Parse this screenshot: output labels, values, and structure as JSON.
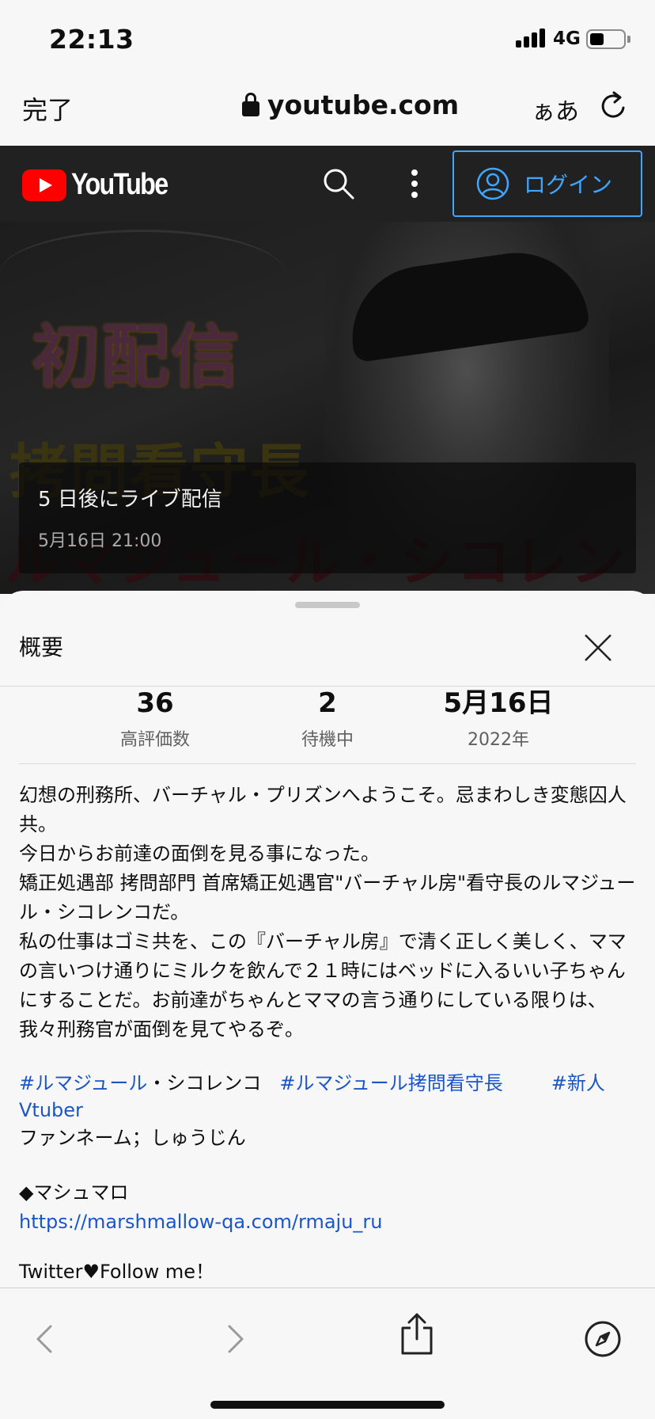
{
  "status_bar": {
    "time": "22:13",
    "network": "4G"
  },
  "safari": {
    "done_label": "完了",
    "address": "youtube.com",
    "text_size_label": "ぁあ"
  },
  "youtube": {
    "logo_text": "YouTube",
    "login_label": "ログイン"
  },
  "video": {
    "thumbnail_title": "初配信",
    "thumbnail_subtitle_1": "拷問看守長",
    "thumbnail_subtitle_2": "ルマジュール・シコレンコ",
    "live_title": "5 日後にライブ配信",
    "live_time": "5月16日 21:00"
  },
  "description": {
    "title": "概要",
    "stats": [
      {
        "value": "36",
        "label": "高評価数"
      },
      {
        "value": "2",
        "label": "待機中"
      },
      {
        "value": "5月16日",
        "label": "2022年"
      }
    ],
    "paragraph_1": "幻想の刑務所、バーチャル・プリズンへようこそ。忌まわしき変態囚人共。",
    "paragraph_2": "今日からお前達の面倒を見る事になった。",
    "paragraph_3": "矯正処遇部 拷問部門 首席矯正処遇官\"バーチャル房\"看守長のルマジュール・シコレンコだ。",
    "paragraph_4": "私の仕事はゴミ共を、この『バーチャル房』で清く正しく美しく、ママの言いつけ通りにミルクを飲んで２１時にはベッドに入るいい子ちゃんにすることだ。お前達がちゃんとママの言う通りにしている限りは、我々刑務官が面倒を見てやるぞ。",
    "hashtag_1": "#ルマジュール",
    "hashtag_1_suffix": "・シコレンコ",
    "hashtag_2": "#ルマジュール拷問看守長",
    "hashtag_3": "#新人Vtuber",
    "fan_name": "ファンネーム；しゅうじん",
    "marshmallow_heading": "◆マシュマロ",
    "marshmallow_link": "https://marshmallow-qa.com/rmaju_ru",
    "twitter_line": "Twitter♥Follow me！"
  },
  "colors": {
    "accent_blue": "#3ea6ff",
    "link_blue": "#1a56c9",
    "youtube_red": "#ff0000",
    "header_bg": "#212121"
  }
}
